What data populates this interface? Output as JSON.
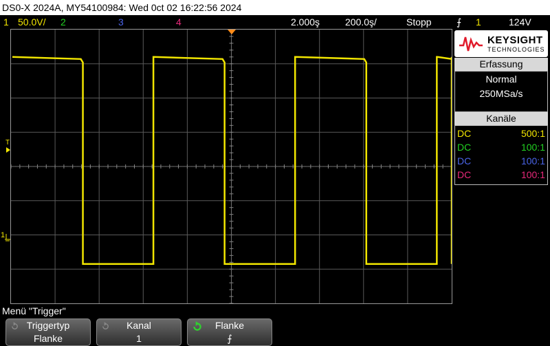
{
  "title": "DS0-X 2024A, MY54100984: Wed 0ct 02 16:22:56 2024",
  "status": {
    "ch1_num": "1",
    "ch1_scale": "50.0V/",
    "ch2_num": "2",
    "ch3_num": "3",
    "ch4_num": "4",
    "timebase": "2.000ş",
    "position": "200.0ş/",
    "run_state": "Stopp",
    "trigger_icon": "rising-edge-icon",
    "trigger_symbol": "⨍",
    "trigger_source": "1",
    "trigger_level": "124V"
  },
  "markers": {
    "trigger_level": "T",
    "ch1_ground": "1"
  },
  "logo": {
    "brand": "KEYSIGHT",
    "sub": "TECHNOLOGIES"
  },
  "acquisition": {
    "header": "Erfassung",
    "mode": "Normal",
    "rate": "250MSa/s"
  },
  "channels": {
    "header": "Kanäle",
    "rows": [
      {
        "coupling": "DC",
        "probe": "500:1",
        "color": "#f2e600"
      },
      {
        "coupling": "DC",
        "probe": "100:1",
        "color": "#22d122"
      },
      {
        "coupling": "DC",
        "probe": "100:1",
        "color": "#4a64e8"
      },
      {
        "coupling": "DC",
        "probe": "100:1",
        "color": "#e8287a"
      }
    ]
  },
  "menu": {
    "title": "Menü \"Trigger\"",
    "softkeys": [
      {
        "label": "Triggertyp",
        "value": "Flanke"
      },
      {
        "label": "Kanal",
        "value": "1"
      },
      {
        "label": "Flanke",
        "value": "⨍"
      }
    ]
  },
  "colors": {
    "ch1": "#f2e600",
    "ch2": "#22d122",
    "ch3": "#4a64e8",
    "ch4": "#e8287a",
    "grid": "#5a5a5a",
    "trigger_marker": "#ff8c1a"
  },
  "trace": {
    "high_level_divisions": 3.2,
    "low_level_divisions": -2.85,
    "period_divisions": 3.2,
    "duty_fraction": 0.5
  }
}
